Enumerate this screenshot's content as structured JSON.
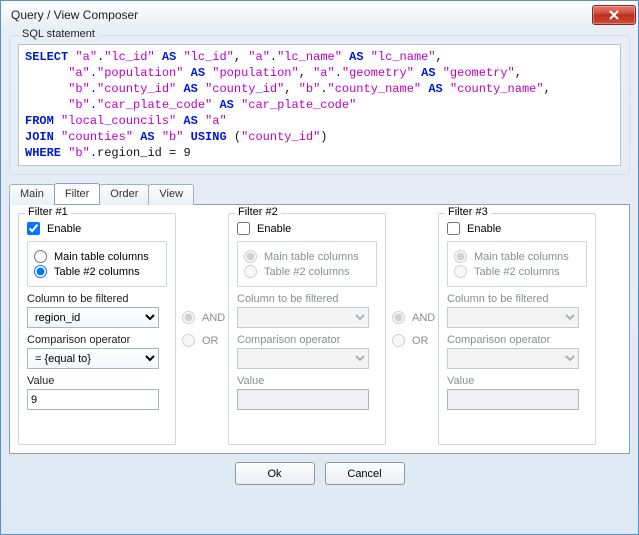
{
  "window": {
    "title": "Query / View Composer"
  },
  "sql_section": {
    "legend": "SQL statement"
  },
  "sql_tokens": [
    {
      "t": "kw",
      "v": "SELECT "
    },
    {
      "t": "id",
      "v": "\"a\""
    },
    {
      "t": "plain",
      "v": "."
    },
    {
      "t": "id",
      "v": "\"lc_id\""
    },
    {
      "t": "kw",
      "v": " AS "
    },
    {
      "t": "id",
      "v": "\"lc_id\""
    },
    {
      "t": "plain",
      "v": ", "
    },
    {
      "t": "id",
      "v": "\"a\""
    },
    {
      "t": "plain",
      "v": "."
    },
    {
      "t": "id",
      "v": "\"lc_name\""
    },
    {
      "t": "kw",
      "v": " AS "
    },
    {
      "t": "id",
      "v": "\"lc_name\""
    },
    {
      "t": "plain",
      "v": ",\n      "
    },
    {
      "t": "id",
      "v": "\"a\""
    },
    {
      "t": "plain",
      "v": "."
    },
    {
      "t": "id",
      "v": "\"population\""
    },
    {
      "t": "kw",
      "v": " AS "
    },
    {
      "t": "id",
      "v": "\"population\""
    },
    {
      "t": "plain",
      "v": ", "
    },
    {
      "t": "id",
      "v": "\"a\""
    },
    {
      "t": "plain",
      "v": "."
    },
    {
      "t": "id",
      "v": "\"geometry\""
    },
    {
      "t": "kw",
      "v": " AS "
    },
    {
      "t": "id",
      "v": "\"geometry\""
    },
    {
      "t": "plain",
      "v": ",\n      "
    },
    {
      "t": "id",
      "v": "\"b\""
    },
    {
      "t": "plain",
      "v": "."
    },
    {
      "t": "id",
      "v": "\"county_id\""
    },
    {
      "t": "kw",
      "v": " AS "
    },
    {
      "t": "id",
      "v": "\"county_id\""
    },
    {
      "t": "plain",
      "v": ", "
    },
    {
      "t": "id",
      "v": "\"b\""
    },
    {
      "t": "plain",
      "v": "."
    },
    {
      "t": "id",
      "v": "\"county_name\""
    },
    {
      "t": "kw",
      "v": " AS "
    },
    {
      "t": "id",
      "v": "\"county_name\""
    },
    {
      "t": "plain",
      "v": ",\n      "
    },
    {
      "t": "id",
      "v": "\"b\""
    },
    {
      "t": "plain",
      "v": "."
    },
    {
      "t": "id",
      "v": "\"car_plate_code\""
    },
    {
      "t": "kw",
      "v": " AS "
    },
    {
      "t": "id",
      "v": "\"car_plate_code\""
    },
    {
      "t": "plain",
      "v": "\n"
    },
    {
      "t": "kw",
      "v": "FROM "
    },
    {
      "t": "id",
      "v": "\"local_councils\""
    },
    {
      "t": "kw",
      "v": " AS "
    },
    {
      "t": "id",
      "v": "\"a\""
    },
    {
      "t": "plain",
      "v": "\n"
    },
    {
      "t": "kw",
      "v": "JOIN "
    },
    {
      "t": "id",
      "v": "\"counties\""
    },
    {
      "t": "kw",
      "v": " AS "
    },
    {
      "t": "id",
      "v": "\"b\""
    },
    {
      "t": "kw",
      "v": " USING "
    },
    {
      "t": "plain",
      "v": "("
    },
    {
      "t": "id",
      "v": "\"county_id\""
    },
    {
      "t": "plain",
      "v": ")\n"
    },
    {
      "t": "kw",
      "v": "WHERE "
    },
    {
      "t": "id",
      "v": "\"b\""
    },
    {
      "t": "plain",
      "v": ".region_id = "
    },
    {
      "t": "num",
      "v": "9"
    }
  ],
  "tabs": {
    "main": "Main",
    "filter": "Filter",
    "order": "Order",
    "view": "View",
    "active": "filter"
  },
  "labels": {
    "enable": "Enable",
    "main_table_cols": "Main table columns",
    "table2_cols": "Table #2 columns",
    "col_to_filter": "Column to be filtered",
    "comparison": "Comparison operator",
    "value": "Value",
    "and": "AND",
    "or": "OR"
  },
  "filters": [
    {
      "legend": "Filter #1",
      "enabled": true,
      "source": "table2",
      "column": "region_id",
      "operator": "= {equal to}",
      "value": "9"
    },
    {
      "legend": "Filter #2",
      "enabled": false,
      "source": "main",
      "column": "",
      "operator": "",
      "value": ""
    },
    {
      "legend": "Filter #3",
      "enabled": false,
      "source": "main",
      "column": "",
      "operator": "",
      "value": ""
    }
  ],
  "connectors": [
    {
      "and": true,
      "or": false
    },
    {
      "and": true,
      "or": false
    }
  ],
  "buttons": {
    "ok": "Ok",
    "cancel": "Cancel"
  }
}
